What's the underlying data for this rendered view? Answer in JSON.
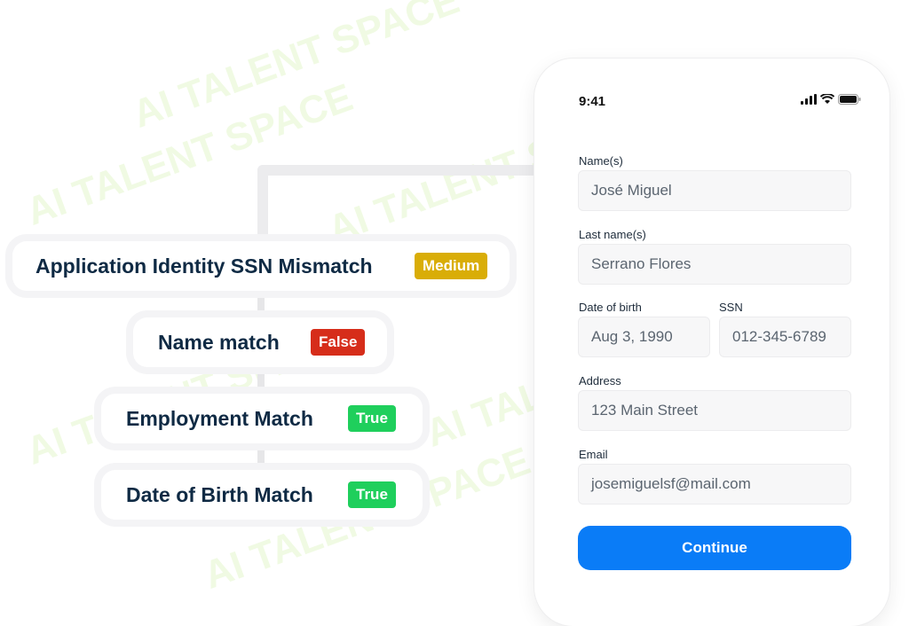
{
  "flow": {
    "main": {
      "title": "Application Identity SSN Mismatch",
      "badge": "Medium"
    },
    "checks": [
      {
        "title": "Name match",
        "badge": "False"
      },
      {
        "title": "Employment Match",
        "badge": "True"
      },
      {
        "title": "Date of Birth Match",
        "badge": "True"
      }
    ]
  },
  "phone": {
    "status_time": "9:41",
    "fields": {
      "names": {
        "label": "Name(s)",
        "value": "José Miguel"
      },
      "last_names": {
        "label": "Last name(s)",
        "value": "Serrano Flores"
      },
      "dob": {
        "label": "Date of birth",
        "value": "Aug 3, 1990"
      },
      "ssn": {
        "label": "SSN",
        "value": "012-345-6789"
      },
      "address": {
        "label": "Address",
        "value": "123 Main Street"
      },
      "email": {
        "label": "Email",
        "value": "josemiguelsf@mail.com"
      }
    },
    "continue_label": "Continue"
  },
  "watermark": "AI TALENT SPACE",
  "colors": {
    "medium": "#d9ad07",
    "false": "#d62d1a",
    "true": "#1fcf5c",
    "primary": "#0a7cf7",
    "text": "#0f2a44"
  }
}
